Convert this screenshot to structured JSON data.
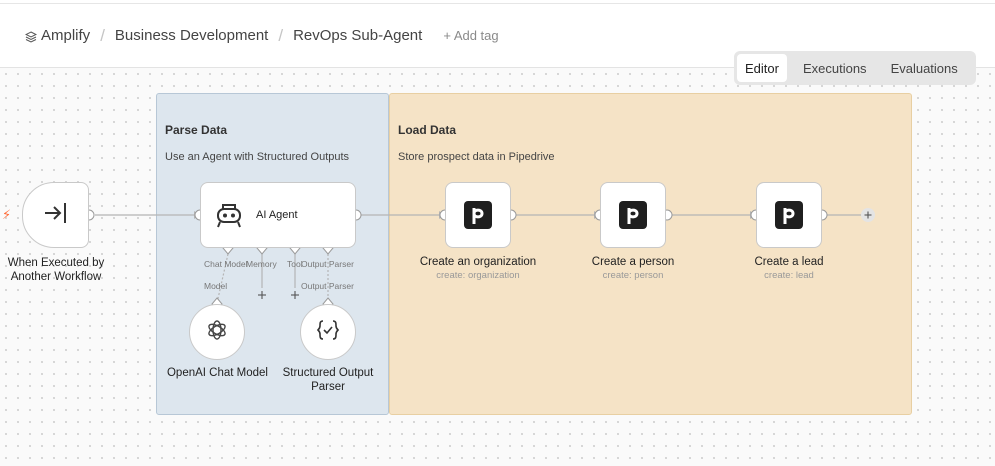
{
  "breadcrumb": {
    "project": "Amplify",
    "folder": "Business Development",
    "workflow": "RevOps Sub-Agent",
    "add_tag": "+ Add tag"
  },
  "view_switcher": {
    "tabs": [
      "Editor",
      "Executions",
      "Evaluations"
    ],
    "active": "Editor"
  },
  "groups": {
    "parse": {
      "title": "Parse Data",
      "subtitle": "Use an Agent with Structured Outputs"
    },
    "load": {
      "title": "Load Data",
      "subtitle": "Store prospect data in Pipedrive"
    }
  },
  "nodes": {
    "trigger": {
      "label": "When Executed by Another Workflow",
      "icon": "enter-arrow-icon"
    },
    "agent": {
      "label": "AI Agent",
      "icon": "robot-icon"
    },
    "org": {
      "label": "Create an organization",
      "sub": "create: organization",
      "icon": "pipedrive-icon"
    },
    "person": {
      "label": "Create a person",
      "sub": "create: person",
      "icon": "pipedrive-icon"
    },
    "lead": {
      "label": "Create a lead",
      "sub": "create: lead",
      "icon": "pipedrive-icon"
    },
    "openai": {
      "label": "OpenAI Chat Model",
      "icon": "openai-icon"
    },
    "parser": {
      "label": "Structured Output Parser",
      "icon": "braces-check-icon"
    }
  },
  "agent_ports": {
    "chat_model": "Chat Model",
    "memory": "Memory",
    "tool": "Tool",
    "output_parser": "Output Parser",
    "model_link": "Model",
    "parser_link": "Output Parser"
  },
  "colors": {
    "parse_group": "#dde6ee",
    "load_group": "#f5e3c6",
    "trigger_bolt": "#ff6d3a"
  }
}
